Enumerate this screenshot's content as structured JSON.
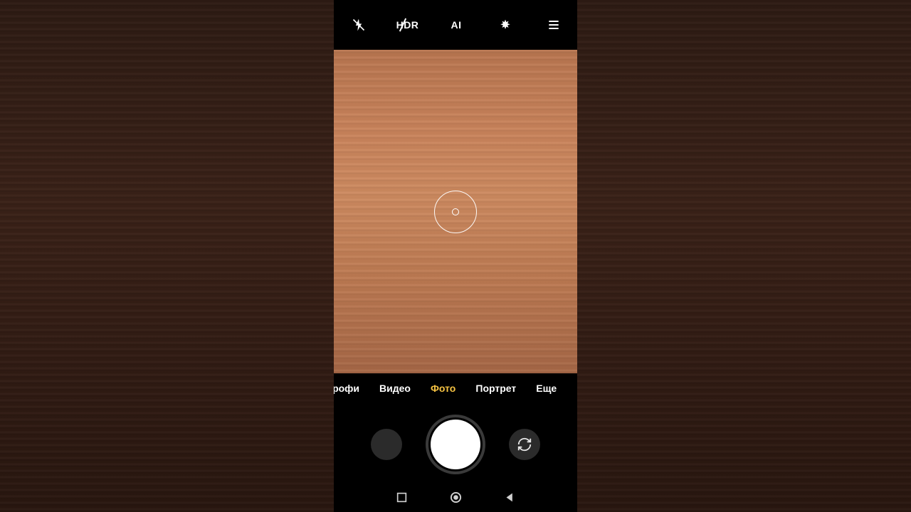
{
  "topbar": {
    "hdr_label": "HDR",
    "ai_label": "AI"
  },
  "modes": {
    "items": [
      "Профи",
      "Видео",
      "Фото",
      "Портрет",
      "Еще"
    ],
    "active_index": 2
  }
}
